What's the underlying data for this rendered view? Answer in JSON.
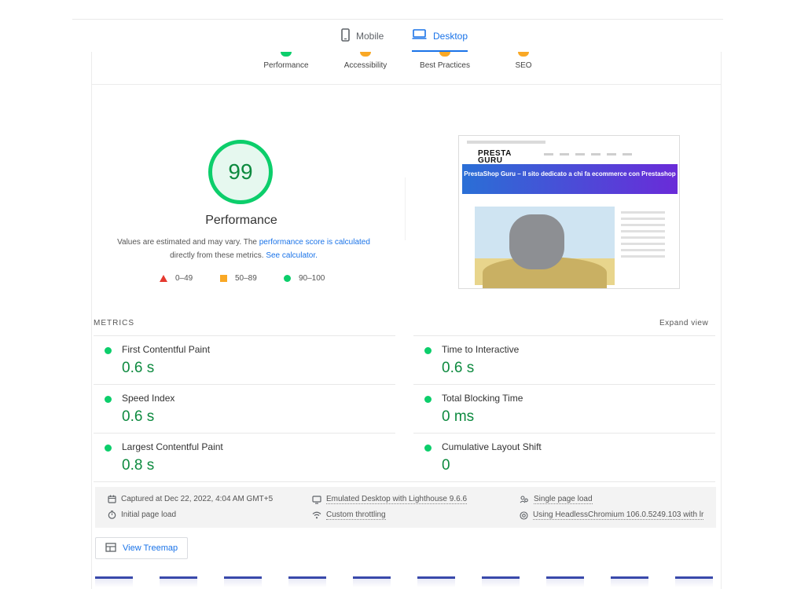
{
  "tabs": {
    "mobile": "Mobile",
    "desktop": "Desktop",
    "active": "desktop"
  },
  "categories": [
    {
      "label": "Performance",
      "color": "#0cce6b"
    },
    {
      "label": "Accessibility",
      "color": "#f9a825"
    },
    {
      "label": "Best Practices",
      "color": "#f9a825"
    },
    {
      "label": "SEO",
      "color": "#f9a825"
    }
  ],
  "score": {
    "value": "99",
    "title": "Performance",
    "note_prefix": "Values are estimated and may vary. The ",
    "note_link1": "performance score is calculated",
    "note_middle": " directly from these metrics. ",
    "note_link2": "See calculator."
  },
  "legend": {
    "low": "0–49",
    "mid": "50–89",
    "high": "90–100"
  },
  "screenshot": {
    "logo_line1": "PRESTA",
    "logo_line2": "GURU",
    "banner": "PrestaShop Guru – Il sito dedicato a chi fa ecommerce con Prestashop"
  },
  "metrics": {
    "heading": "METRICS",
    "expand": "Expand view",
    "items": [
      {
        "name": "First Contentful Paint",
        "value": "0.6 s"
      },
      {
        "name": "Speed Index",
        "value": "0.6 s"
      },
      {
        "name": "Largest Contentful Paint",
        "value": "0.8 s"
      },
      {
        "name": "Time to Interactive",
        "value": "0.6 s"
      },
      {
        "name": "Total Blocking Time",
        "value": "0 ms"
      },
      {
        "name": "Cumulative Layout Shift",
        "value": "0"
      }
    ]
  },
  "info": {
    "captured": "Captured at Dec 22, 2022, 4:04 AM GMT+5",
    "initial": "Initial page load",
    "emulated": "Emulated Desktop with Lighthouse 9.6.6",
    "throttling": "Custom throttling",
    "single": "Single page load",
    "browser": "Using HeadlessChromium 106.0.5249.103 with lr"
  },
  "treemap": {
    "label": "View Treemap"
  },
  "icons": {
    "mobile": "phone-icon",
    "desktop": "laptop-icon",
    "calendar": "calendar-icon",
    "timer": "timer-icon",
    "monitor": "monitor-icon",
    "wifi": "wifi-icon",
    "people": "people-icon",
    "chrome": "browser-icon",
    "treemap": "treemap-icon"
  },
  "colors": {
    "pass": "#0cce6b",
    "average": "#f9a825",
    "fail": "#e5392f",
    "link": "#1a73e8"
  }
}
